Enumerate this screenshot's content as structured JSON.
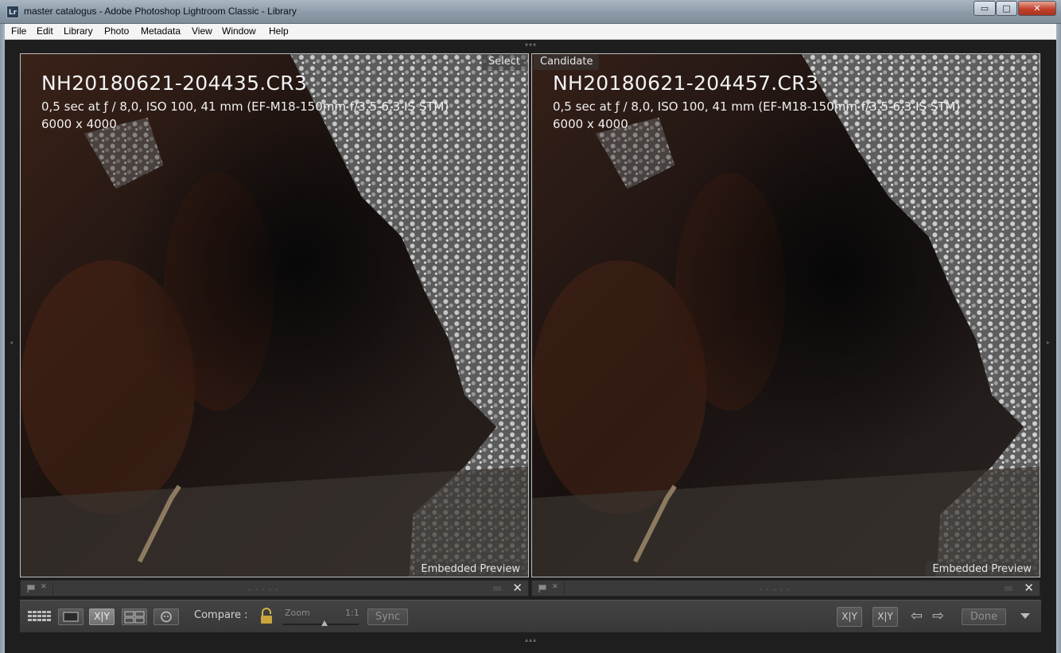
{
  "window": {
    "title": "master catalogus - Adobe Photoshop Lightroom Classic - Library",
    "app_icon": "Lr",
    "controls": {
      "minimize": "▭",
      "maximize": "□",
      "close": "✕"
    }
  },
  "menu": [
    "File",
    "Edit",
    "Library",
    "Photo",
    "Metadata",
    "View",
    "Window",
    "Help"
  ],
  "panels": {
    "select": {
      "role": "Select",
      "filename": "NH20180621-204435.CR3",
      "exif": "0,5 sec at ƒ / 8,0, ISO 100, 41 mm (EF-M18-150mm f/3.5-6.3 IS STM)",
      "dimensions": "6000 x 4000",
      "preview": "Embedded Preview"
    },
    "candidate": {
      "role": "Candidate",
      "filename": "NH20180621-204457.CR3",
      "exif": "0,5 sec at ƒ / 8,0, ISO 100, 41 mm (EF-M18-150mm f/3.5-6.3 IS STM)",
      "dimensions": "6000 x 4000",
      "preview": "Embedded Preview"
    }
  },
  "strip": {
    "dots": ".....",
    "close": "✕",
    "reject": "✕"
  },
  "toolbar": {
    "compare_label": "Compare :",
    "zoom_label": "Zoom",
    "zoom_ratio": "1:1",
    "zoom_level": 0.55,
    "sync_label": "Sync",
    "compare_xy": "X|Y",
    "swap_xy": "X|Y",
    "make_select_xy": "X|Y",
    "prev": "⇦",
    "next": "⇨",
    "done_label": "Done"
  },
  "icons": {
    "grid": "grid-view-icon",
    "loupe": "loupe-view-icon",
    "compare": "compare-view-icon",
    "survey": "survey-view-icon",
    "people": "people-view-icon",
    "lock": "lock-icon",
    "flag": "flag-icon"
  },
  "colors": {
    "panel_bg": "#1e1e1e",
    "toolbar_bg": "#3d3d3d",
    "close_red": "#c2412b"
  }
}
